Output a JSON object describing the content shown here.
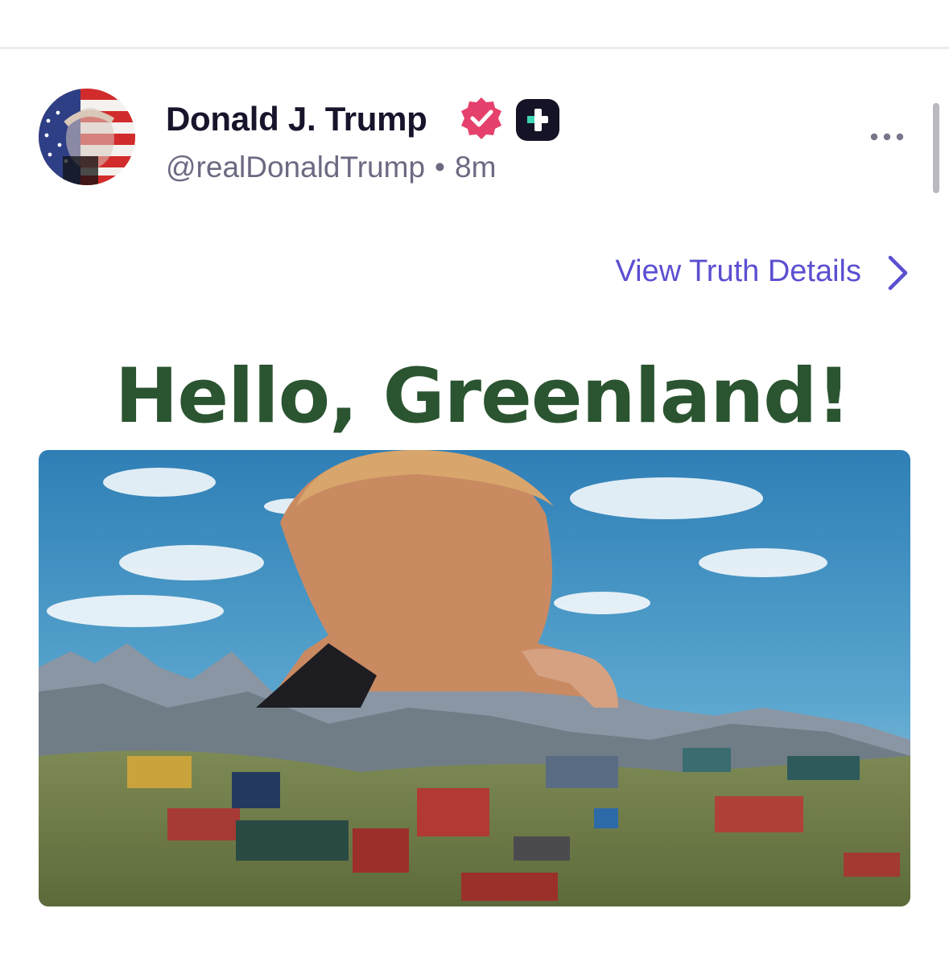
{
  "post": {
    "author_name": "Donald J. Trump",
    "handle": "@realDonaldTrump",
    "separator": "•",
    "time_ago": "8m",
    "view_details_label": "View Truth Details",
    "image_headline": "Hello, Greenland!"
  },
  "icons": {
    "verified": "verified-badge-icon",
    "plus_badge": "plus-badge-icon",
    "more": "more-horizontal-icon",
    "chevron": "chevron-right-icon"
  },
  "colors": {
    "name": "#17152b",
    "secondary_text": "#6b6a82",
    "accent_link": "#5b4fd1",
    "verified_pink": "#e5416c",
    "headline_green": "#2b5430"
  }
}
